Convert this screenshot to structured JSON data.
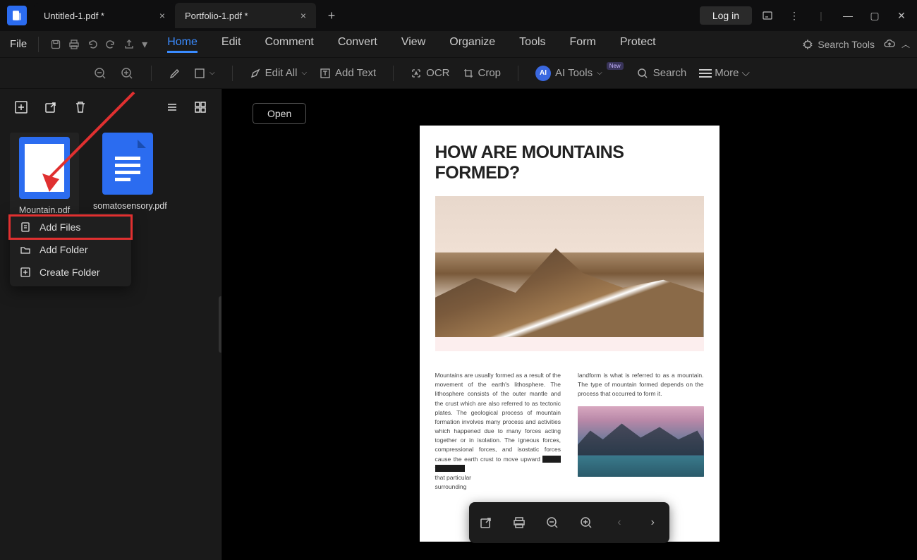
{
  "titlebar": {
    "tabs": [
      {
        "label": "Untitled-1.pdf *"
      },
      {
        "label": "Portfolio-1.pdf *"
      }
    ],
    "login": "Log in"
  },
  "menubar": {
    "file": "File",
    "items": [
      "Home",
      "Edit",
      "Comment",
      "Convert",
      "View",
      "Organize",
      "Tools",
      "Form",
      "Protect"
    ],
    "search_tools": "Search Tools"
  },
  "toolbar": {
    "edit_all": "Edit All",
    "add_text": "Add Text",
    "ocr": "OCR",
    "crop": "Crop",
    "ai_tools": "AI Tools",
    "new_badge": "New",
    "search": "Search",
    "more": "More"
  },
  "sidebar": {
    "files": [
      {
        "name": "Mountain.pdf"
      },
      {
        "name": "somatosensory.pdf"
      }
    ],
    "context_menu": [
      "Add Files",
      "Add Folder",
      "Create Folder"
    ]
  },
  "main": {
    "open": "Open",
    "doc_title": "HOW ARE MOUNTAINS FORMED?",
    "col1": "Mountains are usually formed as a result of the movement of the earth's lithosphere. The lithosphere consists of the outer mantle and the crust which are also referred to as tectonic plates. The geological process of mountain formation involves many process and activities which happened due to many forces acting together or in isolation. The igneous forces, compressional forces, and isostatic forces cause the earth crust to move upward",
    "col1b": "that particular",
    "col1c": "surrounding",
    "col2": "landform is what is referred to as a mountain. The type of mountain formed depends on the process that occurred to form it."
  }
}
